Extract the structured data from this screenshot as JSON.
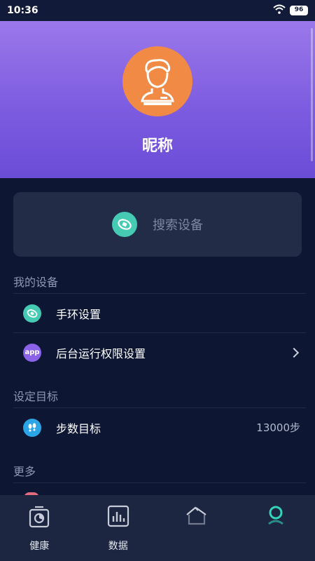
{
  "status_bar": {
    "time": "10:36",
    "battery": "96"
  },
  "profile": {
    "nickname": "昵称"
  },
  "search_device": {
    "label": "搜索设备"
  },
  "sections": {
    "my_devices": {
      "title": "我的设备",
      "items": [
        {
          "label": "手环设置",
          "icon": "band-icon"
        },
        {
          "label": "后台运行权限设置",
          "icon": "app-icon",
          "icon_text": "app"
        }
      ]
    },
    "goals": {
      "title": "设定目标",
      "items": [
        {
          "label": "步数目标",
          "icon": "footprint-icon",
          "value": "13000步"
        }
      ]
    },
    "more": {
      "title": "更多"
    }
  },
  "bottom_nav": {
    "items": [
      {
        "label": "健康",
        "icon": "health-icon"
      },
      {
        "label": "数据",
        "icon": "data-chart-icon"
      },
      {
        "label": "",
        "icon": "home-icon"
      },
      {
        "label": "",
        "icon": "profile-icon"
      }
    ]
  },
  "colors": {
    "background": "#0d1733",
    "header_top": "#9b78ea",
    "header_bottom": "#6a4cd6",
    "avatar": "#f08a45",
    "teal": "#45cbb4",
    "app_icon": "#8a63e8",
    "steps_icon": "#2ba5e6"
  }
}
